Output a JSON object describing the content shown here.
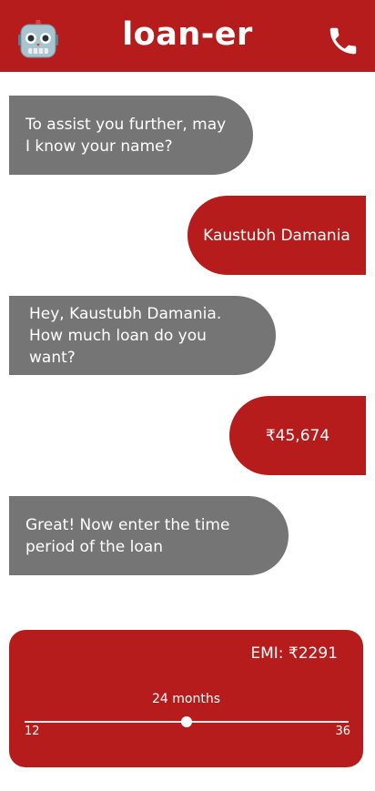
{
  "header": {
    "title": "loan-er",
    "left_icon": "robot-icon",
    "right_icon": "phone-icon"
  },
  "messages": [
    {
      "from": "bot",
      "text": "To assist you further, may I know your name?"
    },
    {
      "from": "user",
      "text": "Kaustubh Damania"
    },
    {
      "from": "bot",
      "text": "Hey, Kaustubh Damania. How much loan do you want?"
    },
    {
      "from": "user",
      "text": "₹45,674"
    },
    {
      "from": "bot",
      "text": "Great! Now enter the time period of the loan"
    }
  ],
  "emi_card": {
    "emi_text": "EMI: ₹2291",
    "months_text": "24 months",
    "slider": {
      "min": 12,
      "max": 36,
      "value": 24,
      "min_label": "12",
      "max_label": "36"
    }
  },
  "colors": {
    "brand": "#b71c1c",
    "bot_bubble": "#757575",
    "text": "#ffffff"
  }
}
